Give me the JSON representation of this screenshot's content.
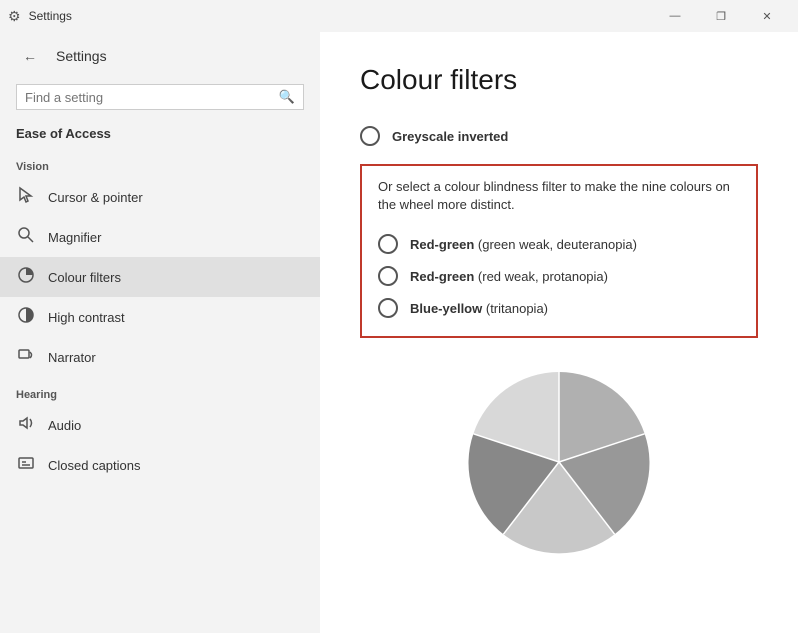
{
  "titlebar": {
    "title": "Settings",
    "minimize": "—",
    "maximize": "❐",
    "close": "✕"
  },
  "sidebar": {
    "back_label": "←",
    "app_title": "Settings",
    "search_placeholder": "Find a setting",
    "ease_label": "Ease of Access",
    "vision_label": "Vision",
    "nav_items": [
      {
        "id": "cursor",
        "label": "Cursor & pointer",
        "icon": "🖱"
      },
      {
        "id": "magnifier",
        "label": "Magnifier",
        "icon": "🔍"
      },
      {
        "id": "colour-filters",
        "label": "Colour filters",
        "icon": "🎨"
      },
      {
        "id": "high-contrast",
        "label": "High contrast",
        "icon": "☀"
      },
      {
        "id": "narrator",
        "label": "Narrator",
        "icon": "💬"
      }
    ],
    "hearing_label": "Hearing",
    "hearing_items": [
      {
        "id": "audio",
        "label": "Audio",
        "icon": "🔊"
      },
      {
        "id": "closed-captions",
        "label": "Closed captions",
        "icon": "💬"
      }
    ]
  },
  "content": {
    "page_title": "Colour filters",
    "greyscale_inverted": "Greyscale inverted",
    "blindness_description": "Or select a colour blindness filter to make the nine colours on the wheel more distinct.",
    "radio_options": [
      {
        "id": "red-green-weak",
        "bold": "Red-green",
        "detail": " (green weak, deuteranopia)"
      },
      {
        "id": "red-green-strong",
        "bold": "Red-green",
        "detail": " (red weak, protanopia)"
      },
      {
        "id": "blue-yellow",
        "bold": "Blue-yellow",
        "detail": " (tritanopia)"
      }
    ]
  }
}
